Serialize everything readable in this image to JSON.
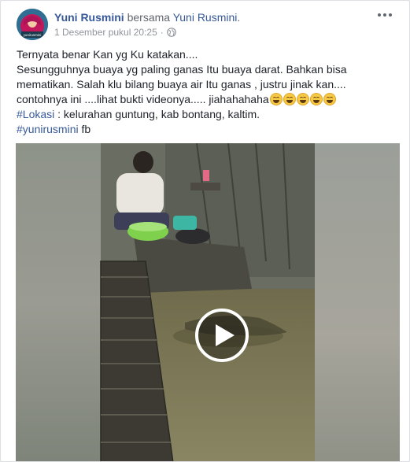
{
  "post": {
    "author": "Yuni Rusmini",
    "with_text": "bersama",
    "tagged": "Yuni Rusmini",
    "tagged_suffix": ".",
    "timestamp": "1 Desember pukul 20:25",
    "separator": "·",
    "privacy_icon": "globe-icon",
    "more_icon": "ellipsis-icon",
    "avatar_text": "yunirusmini",
    "text": {
      "line1": "Ternyata benar Kan yg Ku katakan....",
      "line2": "Sesungguhnya buaya yg paling ganas Itu buaya darat. Bahkan bisa",
      "line3": "mematikan. Salah klu bilang buaya air Itu ganas , justru jinak kan....",
      "line4": "contohnya ini ....lihat bukti videonya..... jiahahahaha",
      "line4_emoji_count": 5,
      "location_tag": "#Lokasi",
      "location_text": " : kelurahan guntung, kab bontang, kaltim.",
      "hashtag": "#yunirusmini",
      "hashtag_suffix": " fb"
    },
    "video": {
      "play_icon": "play-icon"
    }
  },
  "colors": {
    "link": "#365899",
    "text": "#1d2129",
    "meta": "#90949c",
    "border": "#dddfe2"
  }
}
